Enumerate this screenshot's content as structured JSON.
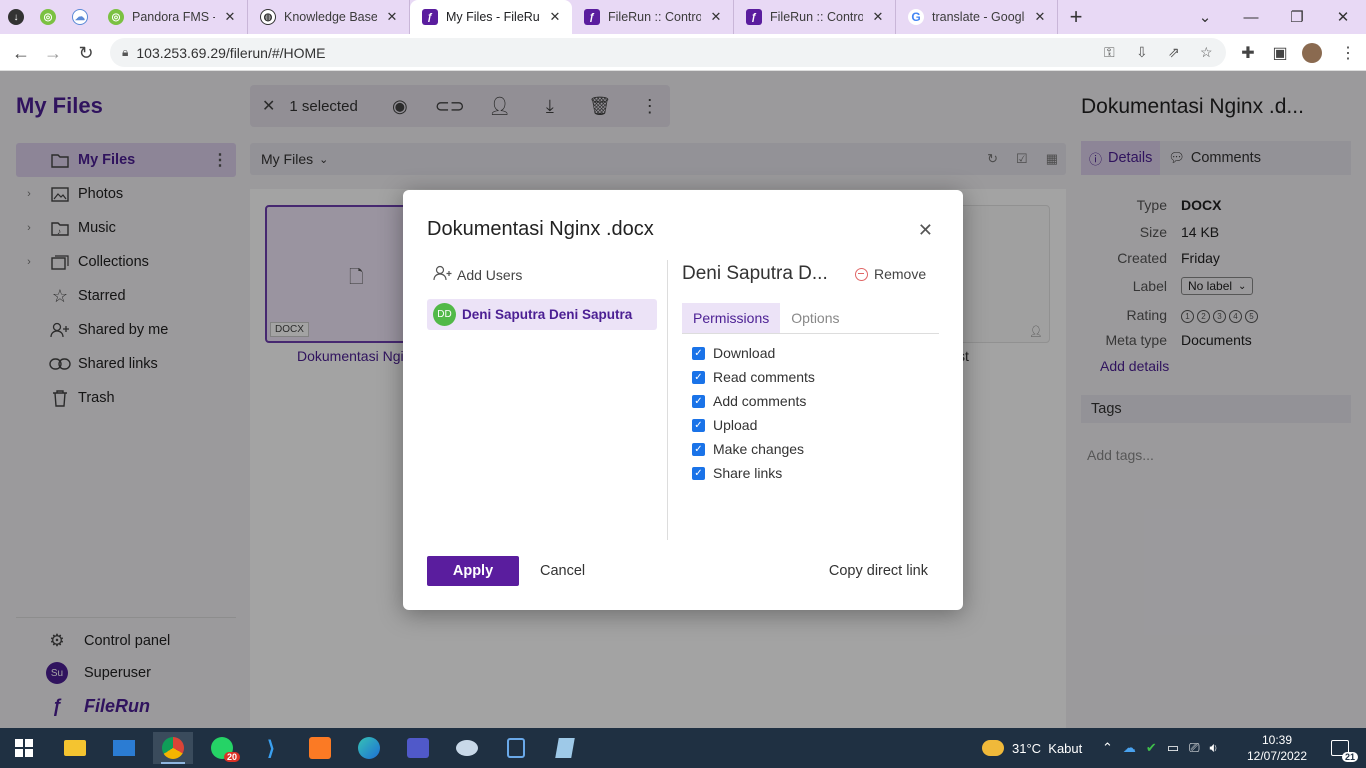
{
  "browser": {
    "tabs": [
      {
        "title": "Pandora FMS - the"
      },
      {
        "title": "Knowledge Base C"
      },
      {
        "title": "My Files - FileRun"
      },
      {
        "title": "FileRun :: Control F"
      },
      {
        "title": "FileRun :: Control F"
      },
      {
        "title": "translate - Google"
      }
    ],
    "url": "103.253.69.29/filerun/#/HOME"
  },
  "sidebar": {
    "title": "My Files",
    "items": [
      {
        "label": "My Files",
        "icon": "folder-icon"
      },
      {
        "label": "Photos",
        "icon": "image-icon"
      },
      {
        "label": "Music",
        "icon": "music-icon"
      },
      {
        "label": "Collections",
        "icon": "collection-icon"
      },
      {
        "label": "Starred",
        "icon": "star-icon"
      },
      {
        "label": "Shared by me",
        "icon": "user-plus-icon"
      },
      {
        "label": "Shared links",
        "icon": "link-icon"
      },
      {
        "label": "Trash",
        "icon": "trash-icon"
      }
    ],
    "control_panel": "Control panel",
    "user": "Superuser",
    "user_initials": "Su",
    "brand": "FileRun"
  },
  "selection_bar": {
    "text": "1 selected"
  },
  "path": {
    "label": "My Files"
  },
  "files": {
    "selected_name": "Dokumentasi Ngi",
    "selected_ext": "DOCX",
    "other_name_tail": "st"
  },
  "details": {
    "title": "Dokumentasi Nginx .d...",
    "tab_details": "Details",
    "tab_comments": "Comments",
    "rows": [
      {
        "key": "Type",
        "value": "DOCX"
      },
      {
        "key": "Size",
        "value": "14 KB"
      },
      {
        "key": "Created",
        "value": "Friday"
      },
      {
        "key": "Label",
        "value": "No label"
      },
      {
        "key": "Rating",
        "value": ""
      },
      {
        "key": "Meta type",
        "value": "Documents"
      }
    ],
    "add_details": "Add details",
    "tags_header": "Tags",
    "tags_placeholder": "Add tags..."
  },
  "modal": {
    "title": "Dokumentasi Nginx .docx",
    "add_users": "Add Users",
    "user_initials": "DD",
    "user_name": "Deni Saputra Deni Saputra",
    "selected_user_title": "Deni Saputra D...",
    "remove": "Remove",
    "tab_permissions": "Permissions",
    "tab_options": "Options",
    "permissions": [
      {
        "label": "Download",
        "checked": true
      },
      {
        "label": "Read comments",
        "checked": true
      },
      {
        "label": "Add comments",
        "checked": true
      },
      {
        "label": "Upload",
        "checked": true
      },
      {
        "label": "Make changes",
        "checked": true
      },
      {
        "label": "Share links",
        "checked": true
      }
    ],
    "apply": "Apply",
    "cancel": "Cancel",
    "copy_link": "Copy direct link"
  },
  "taskbar": {
    "weather": "31°C  Kabut",
    "time": "10:39",
    "date": "12/07/2022",
    "whatsapp_badge": "20",
    "notifications": "21"
  }
}
